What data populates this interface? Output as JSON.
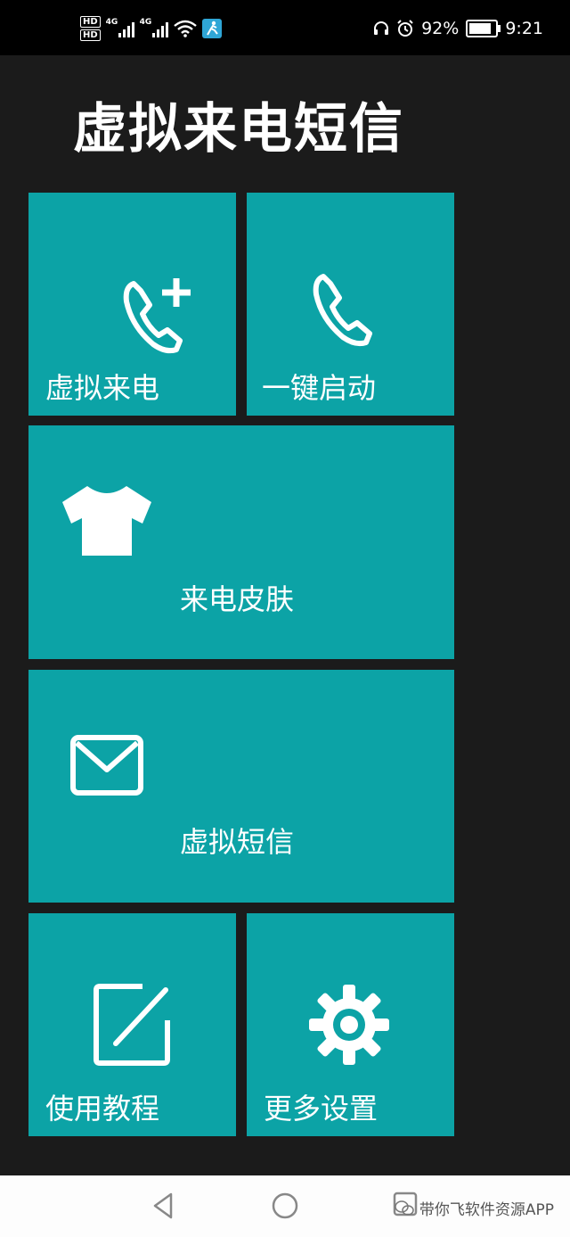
{
  "status_bar": {
    "hd1": "HD",
    "hd2": "HD",
    "net1": "4G",
    "net2": "4G",
    "battery_percent": "92%",
    "battery_level": 0.92,
    "time": "9:21",
    "icons": [
      "headset-icon",
      "alarm-icon",
      "battery-icon",
      "wifi-icon",
      "app-notification-icon"
    ]
  },
  "app": {
    "title": "虚拟来电短信"
  },
  "tiles": {
    "virtual_call": {
      "label": "虚拟来电",
      "icon": "phone-plus-icon"
    },
    "one_key_start": {
      "label": "一键启动",
      "icon": "phone-icon"
    },
    "call_skin": {
      "label": "来电皮肤",
      "icon": "tshirt-icon"
    },
    "virtual_sms": {
      "label": "虚拟短信",
      "icon": "envelope-icon"
    },
    "tutorial": {
      "label": "使用教程",
      "icon": "edit-icon"
    },
    "more_settings": {
      "label": "更多设置",
      "icon": "gear-icon"
    }
  },
  "colors": {
    "tile": "#0ca3a6",
    "background": "#1b1b1b"
  },
  "nav": {
    "watermark": "带你飞软件资源APP"
  }
}
